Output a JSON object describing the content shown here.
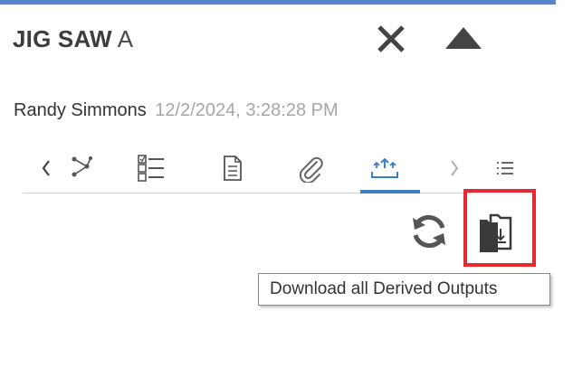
{
  "header": {
    "title": "JIG SAW",
    "revision": "A",
    "accent_color": "#5b86c5"
  },
  "meta": {
    "user": "Randy Simmons",
    "timestamp": "12/2/2024, 3:28:28 PM"
  },
  "tabs": [
    {
      "icon": "chevron-left-icon"
    },
    {
      "icon": "structure-graph-icon"
    },
    {
      "icon": "checklist-icon"
    },
    {
      "icon": "document-icon"
    },
    {
      "icon": "paperclip-icon"
    },
    {
      "icon": "upload-output-icon",
      "active": true
    },
    {
      "icon": "chevron-right-icon"
    },
    {
      "icon": "list-icon"
    }
  ],
  "actions": {
    "refresh_icon": "refresh-icon",
    "download_icon": "download-folders-icon",
    "highlight_color": "#e52b31"
  },
  "tooltip": {
    "text": "Download all Derived Outputs"
  }
}
